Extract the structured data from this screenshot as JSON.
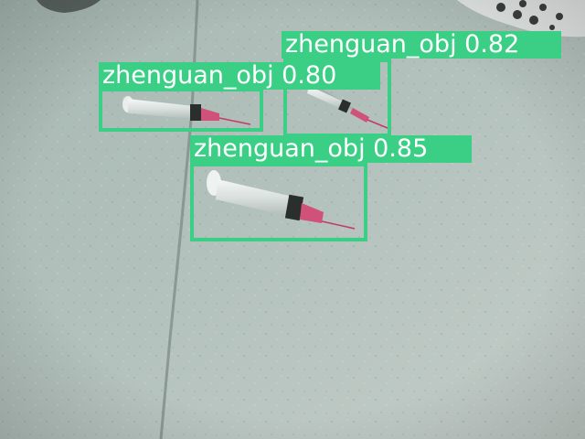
{
  "detections": [
    {
      "class_label": "zhenguan_obj",
      "score": "0.82"
    },
    {
      "class_label": "zhenguan_obj",
      "score": "0.80"
    },
    {
      "class_label": "zhenguan_obj",
      "score": "0.85"
    }
  ],
  "colors": {
    "box": "#3bcf86",
    "label_text": "#ffffff",
    "floor": "#aebbb6",
    "syringe_tip": "#d0527a"
  }
}
